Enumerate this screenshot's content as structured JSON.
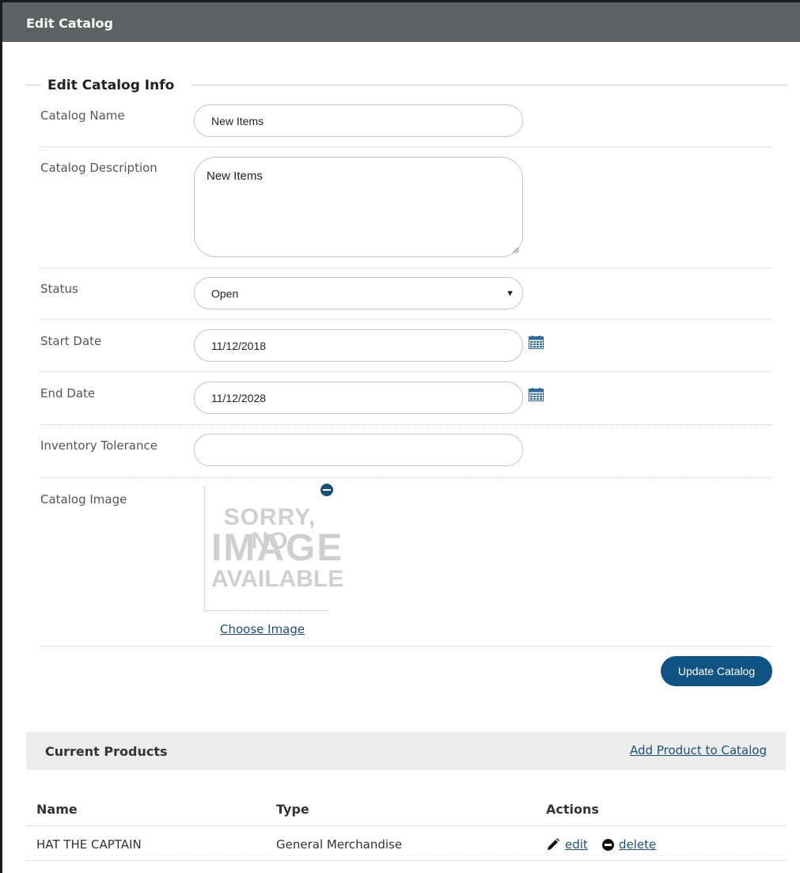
{
  "window": {
    "title": "Edit Catalog"
  },
  "form": {
    "legend": "Edit Catalog Info",
    "catalog_name": {
      "label": "Catalog Name",
      "value": "New Items"
    },
    "catalog_description": {
      "label": "Catalog Description",
      "value": "New Items"
    },
    "status": {
      "label": "Status",
      "value": "Open"
    },
    "start_date": {
      "label": "Start Date",
      "value": "11/12/2018",
      "icon": "calendar-icon"
    },
    "end_date": {
      "label": "End Date",
      "value": "11/12/2028",
      "icon": "calendar-icon"
    },
    "inventory_tolerance": {
      "label": "Inventory Tolerance",
      "value": ""
    },
    "catalog_image": {
      "label": "Catalog Image",
      "placeholder_lines": [
        "SORRY, NO",
        "IMAGE",
        "AVAILABLE"
      ],
      "remove_icon": "minus-circle-icon",
      "choose_label": "Choose Image"
    },
    "update_label": "Update Catalog"
  },
  "products": {
    "title": "Current Products",
    "add_label": "Add Product to Catalog",
    "columns": [
      "Name",
      "Type",
      "Actions"
    ],
    "rows": [
      {
        "name": "HAT THE CAPTAIN",
        "type": "General Merchandise",
        "edit_label": "edit",
        "delete_label": "delete"
      }
    ]
  },
  "colors": {
    "titlebar": "#5f6062",
    "accent": "#0f5382",
    "link": "#1c4f74",
    "panel": "#ececec"
  }
}
